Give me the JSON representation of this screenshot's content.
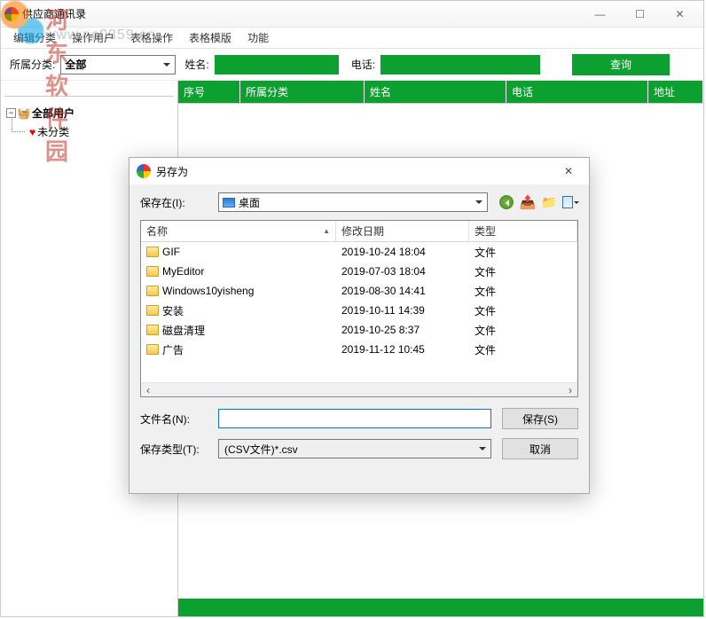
{
  "watermark": {
    "line1": "河东软件园",
    "line2": "www.pc0359.cn"
  },
  "window": {
    "title": "供应商通讯录"
  },
  "win_controls": {
    "min": "—",
    "max": "☐",
    "close": "✕"
  },
  "menu": {
    "edit_cat": "编辑分类",
    "op_user": "操作用户",
    "table_op": "表格操作",
    "table_tpl": "表格模版",
    "func": "功能"
  },
  "filter": {
    "cat_label": "所属分类:",
    "cat_value": "全部",
    "name_label": "姓名:",
    "name_value": "",
    "phone_label": "电话:",
    "phone_value": "",
    "query": "查询"
  },
  "tree": {
    "root": "全部用户",
    "child": "未分类",
    "expander": "−"
  },
  "grid": {
    "cols": {
      "seq": "序号",
      "cat": "所属分类",
      "name": "姓名",
      "phone": "电话",
      "addr": "地址"
    }
  },
  "dialog": {
    "title": "另存为",
    "close": "✕",
    "save_in_label": "保存在(I):",
    "location": "桌面",
    "lv_head": {
      "name": "名称",
      "date": "修改日期",
      "type": "类型"
    },
    "rows": [
      {
        "name": "GIF",
        "date": "2019-10-24 18:04",
        "type": "文件"
      },
      {
        "name": "MyEditor",
        "date": "2019-07-03 18:04",
        "type": "文件"
      },
      {
        "name": "Windows10yisheng",
        "date": "2019-08-30 14:41",
        "type": "文件"
      },
      {
        "name": "安装",
        "date": "2019-10-11 14:39",
        "type": "文件"
      },
      {
        "name": "磁盘清理",
        "date": "2019-10-25 8:37",
        "type": "文件"
      },
      {
        "name": "广告",
        "date": "2019-11-12 10:45",
        "type": "文件"
      }
    ],
    "filename_label": "文件名(N):",
    "filename_value": "",
    "filetype_label": "保存类型(T):",
    "filetype_value": "(CSV文件)*.csv",
    "save_btn": "保存(S)",
    "cancel_btn": "取消",
    "scroll_left": "‹",
    "scroll_right": "›"
  }
}
